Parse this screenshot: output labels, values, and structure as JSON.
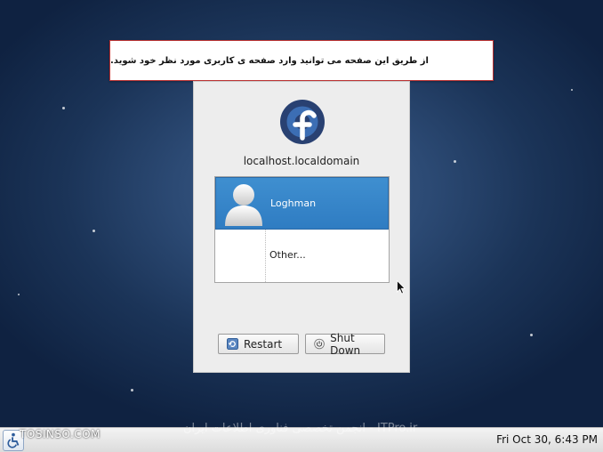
{
  "banner": {
    "text": "از طریق این صفحه می توانید وارد صفحه ی کاربری مورد نظر خود شوید."
  },
  "login": {
    "hostname": "localhost.localdomain",
    "users": [
      {
        "name": "Loghman",
        "selected": true
      },
      {
        "name": "Other...",
        "selected": false
      }
    ]
  },
  "buttons": {
    "restart_label": "Restart",
    "shutdown_label": "Shut Down"
  },
  "taskbar": {
    "clock": "Fri Oct 30,  6:43 PM"
  },
  "watermarks": {
    "left": "TOSINSO.COM",
    "center": "ITPro.ir - انجمن تخصصی فناوری اطلاعات ایران"
  },
  "colors": {
    "selection": "#3584c9",
    "banner_border": "#b33333",
    "fedora_blue": "#294172"
  },
  "icons": {
    "logo": "fedora-logo",
    "avatar": "user-avatar-icon",
    "restart": "restart-icon",
    "shutdown": "shutdown-icon",
    "accessibility": "accessibility-icon"
  }
}
